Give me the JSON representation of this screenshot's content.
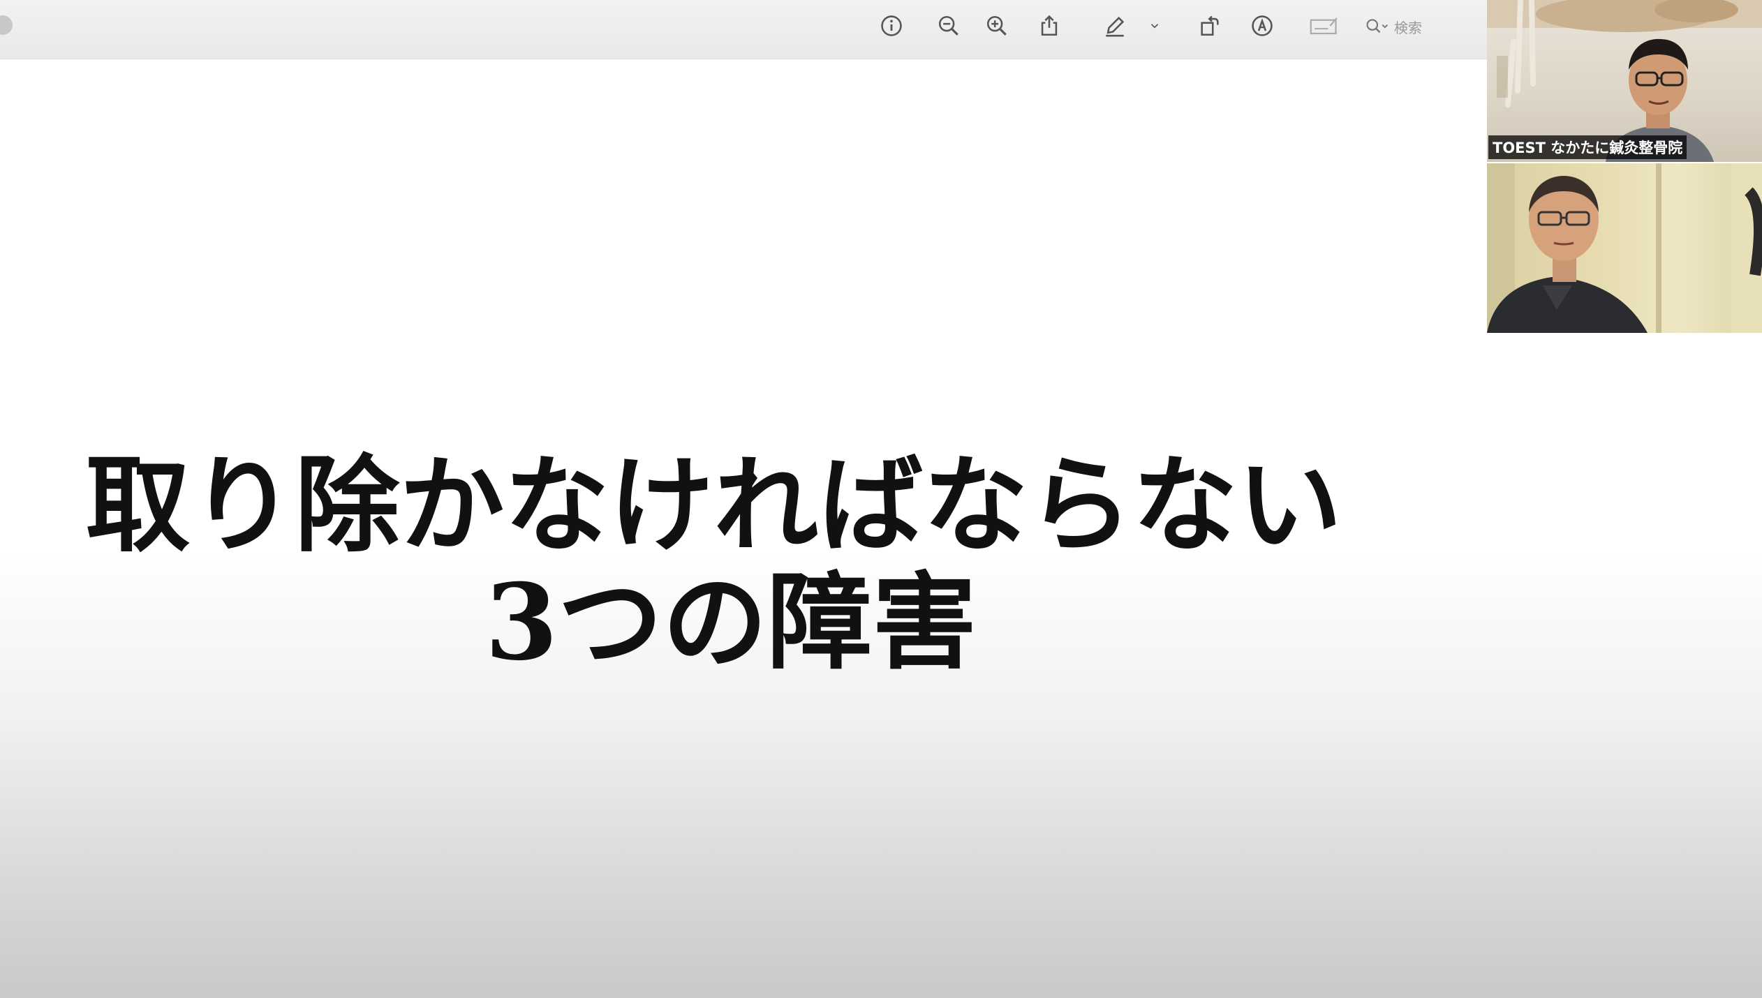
{
  "toolbar": {
    "icons": [
      "info-icon",
      "zoom-out-icon",
      "zoom-in-icon",
      "share-icon",
      "markup-pen-icon",
      "chevron-down-icon",
      "rotate-icon",
      "annotate-icon",
      "form-icon"
    ],
    "search": {
      "icon": "search-icon",
      "placeholder": "検索"
    }
  },
  "slide": {
    "line1": "取り除かなければならない",
    "line2": "3つの障害"
  },
  "participants": [
    {
      "label": "TOEST なかたに鍼灸整骨院"
    },
    {
      "label": ""
    }
  ]
}
